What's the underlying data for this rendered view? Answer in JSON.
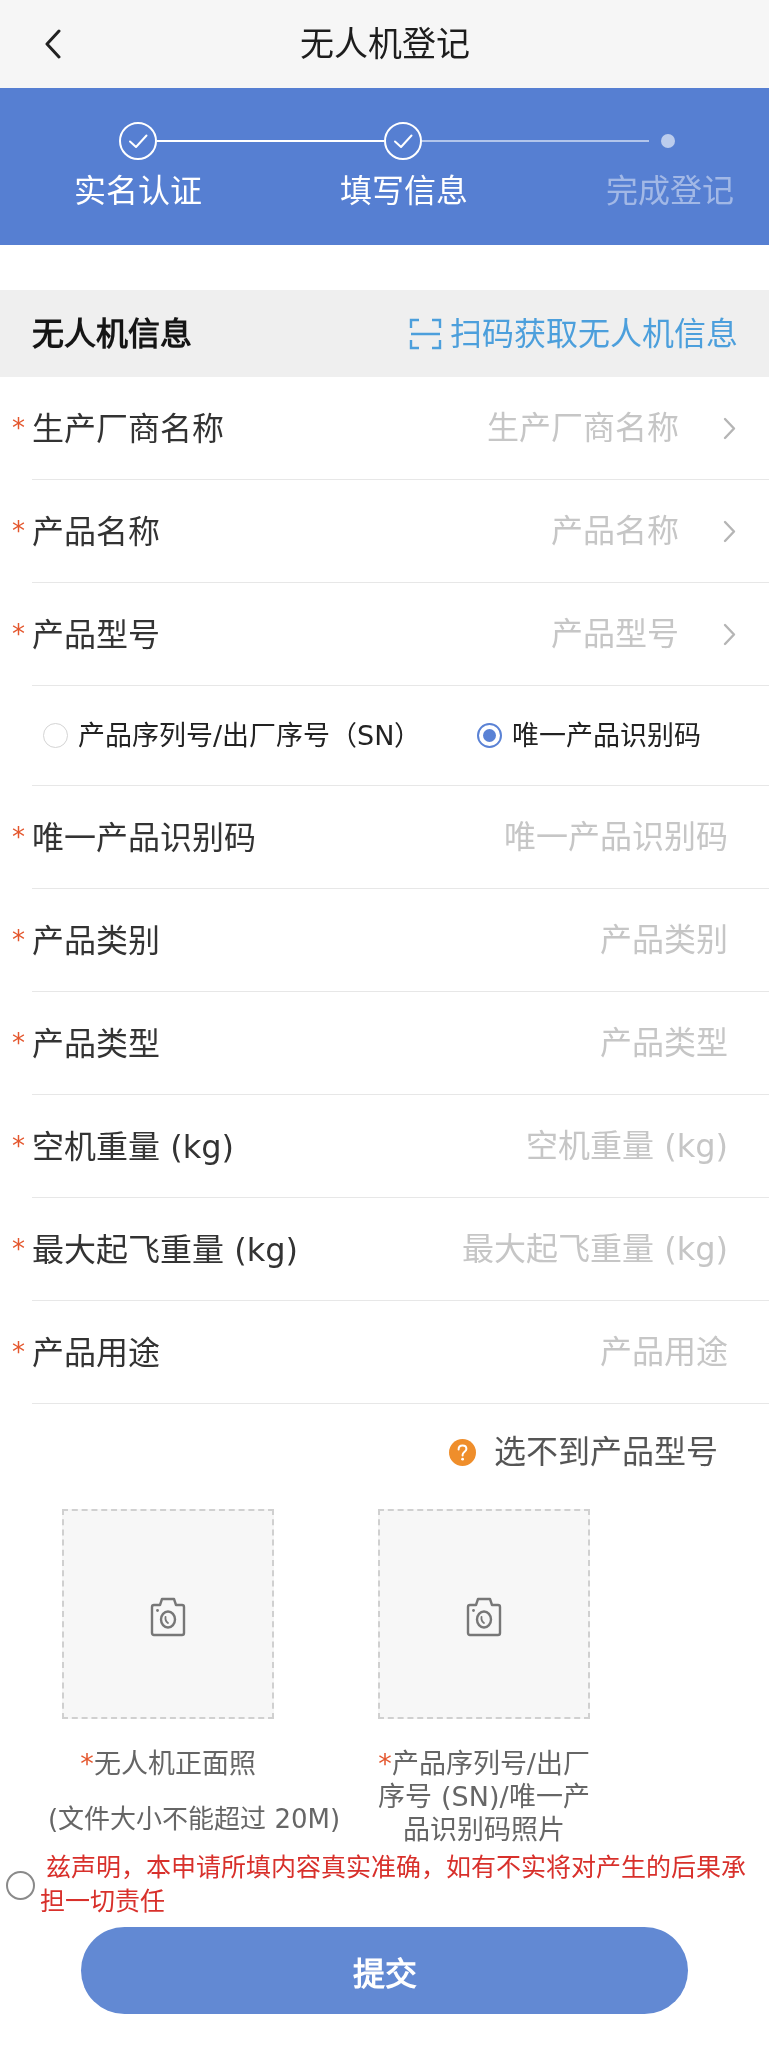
{
  "header": {
    "title": "无人机登记"
  },
  "steps": [
    {
      "label": "实名认证",
      "completed": true
    },
    {
      "label": "填写信息",
      "completed": true
    },
    {
      "label": "完成登记",
      "completed": false
    }
  ],
  "section": {
    "title": "无人机信息",
    "action": "扫码获取无人机信息"
  },
  "fields": [
    {
      "kind": "select",
      "mark": "*",
      "label": "生产厂商名称",
      "placeholder": "生产厂商名称"
    },
    {
      "kind": "select",
      "mark": "*",
      "label": "产品名称",
      "placeholder": "产品名称"
    },
    {
      "kind": "select",
      "mark": "*",
      "label": "产品型号",
      "placeholder": "产品型号"
    },
    {
      "kind": "radio",
      "options": [
        {
          "label": "产品序列号/出厂序号（SN）",
          "selected": false
        },
        {
          "label": "唯一产品识别码",
          "selected": true
        }
      ]
    },
    {
      "kind": "input",
      "mark": "*",
      "label": "唯一产品识别码",
      "placeholder": "唯一产品识别码"
    },
    {
      "kind": "input",
      "mark": "*",
      "label": "产品类别",
      "placeholder": "产品类别"
    },
    {
      "kind": "input",
      "mark": "*",
      "label": "产品类型",
      "placeholder": "产品类型"
    },
    {
      "kind": "input",
      "mark": "*",
      "label": "空机重量 (kg)",
      "placeholder": "空机重量 (kg)"
    },
    {
      "kind": "input",
      "mark": "*",
      "label": "最大起飞重量 (kg)",
      "placeholder": "最大起飞重量 (kg)"
    },
    {
      "kind": "input",
      "mark": "*",
      "label": "产品用途",
      "placeholder": "产品用途"
    }
  ],
  "help_link": "选不到产品型号",
  "uploads": [
    {
      "mark": "*",
      "caption": "无人机正面照",
      "note": "(文件大小不能超过 20M)"
    },
    {
      "mark": "*",
      "caption": "产品序列号/出厂序号 (SN)/唯一产品识别码照片"
    }
  ],
  "declaration": {
    "checked": false,
    "text": "兹声明，本申请所填内容真实准确，如有不实将对产生的后果承担一切责任"
  },
  "submit": "提交"
}
